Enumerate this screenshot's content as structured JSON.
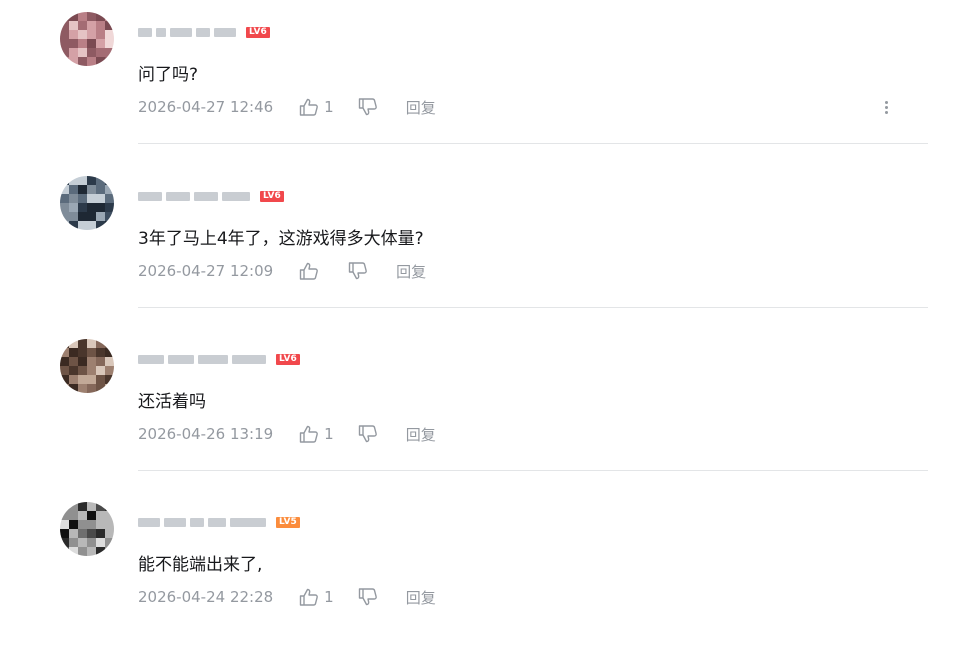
{
  "comments": [
    {
      "level": "LV6",
      "text": "问了吗?",
      "timestamp": "2026-04-27 12:46",
      "likes": "1",
      "reply_label": "回复",
      "has_more_menu": true
    },
    {
      "level": "LV6",
      "text": "3年了马上4年了，这游戏得多大体量?",
      "timestamp": "2026-04-27 12:09",
      "likes": "",
      "reply_label": "回复",
      "has_more_menu": false
    },
    {
      "level": "LV6",
      "text": "还活着吗",
      "timestamp": "2026-04-26 13:19",
      "likes": "1",
      "reply_label": "回复",
      "has_more_menu": false
    },
    {
      "level": "LV5",
      "text": "能不能端出来了,",
      "timestamp": "2026-04-24 22:28",
      "likes": "1",
      "reply_label": "回复",
      "has_more_menu": false
    }
  ],
  "colors": {
    "level6": "#f1484c",
    "level5": "#fb8c3c",
    "meta_text": "#9499a0",
    "divider": "#e3e5e7"
  },
  "icons": {
    "like": "thumbs-up-icon",
    "dislike": "thumbs-down-icon",
    "more": "more-vertical-icon"
  }
}
